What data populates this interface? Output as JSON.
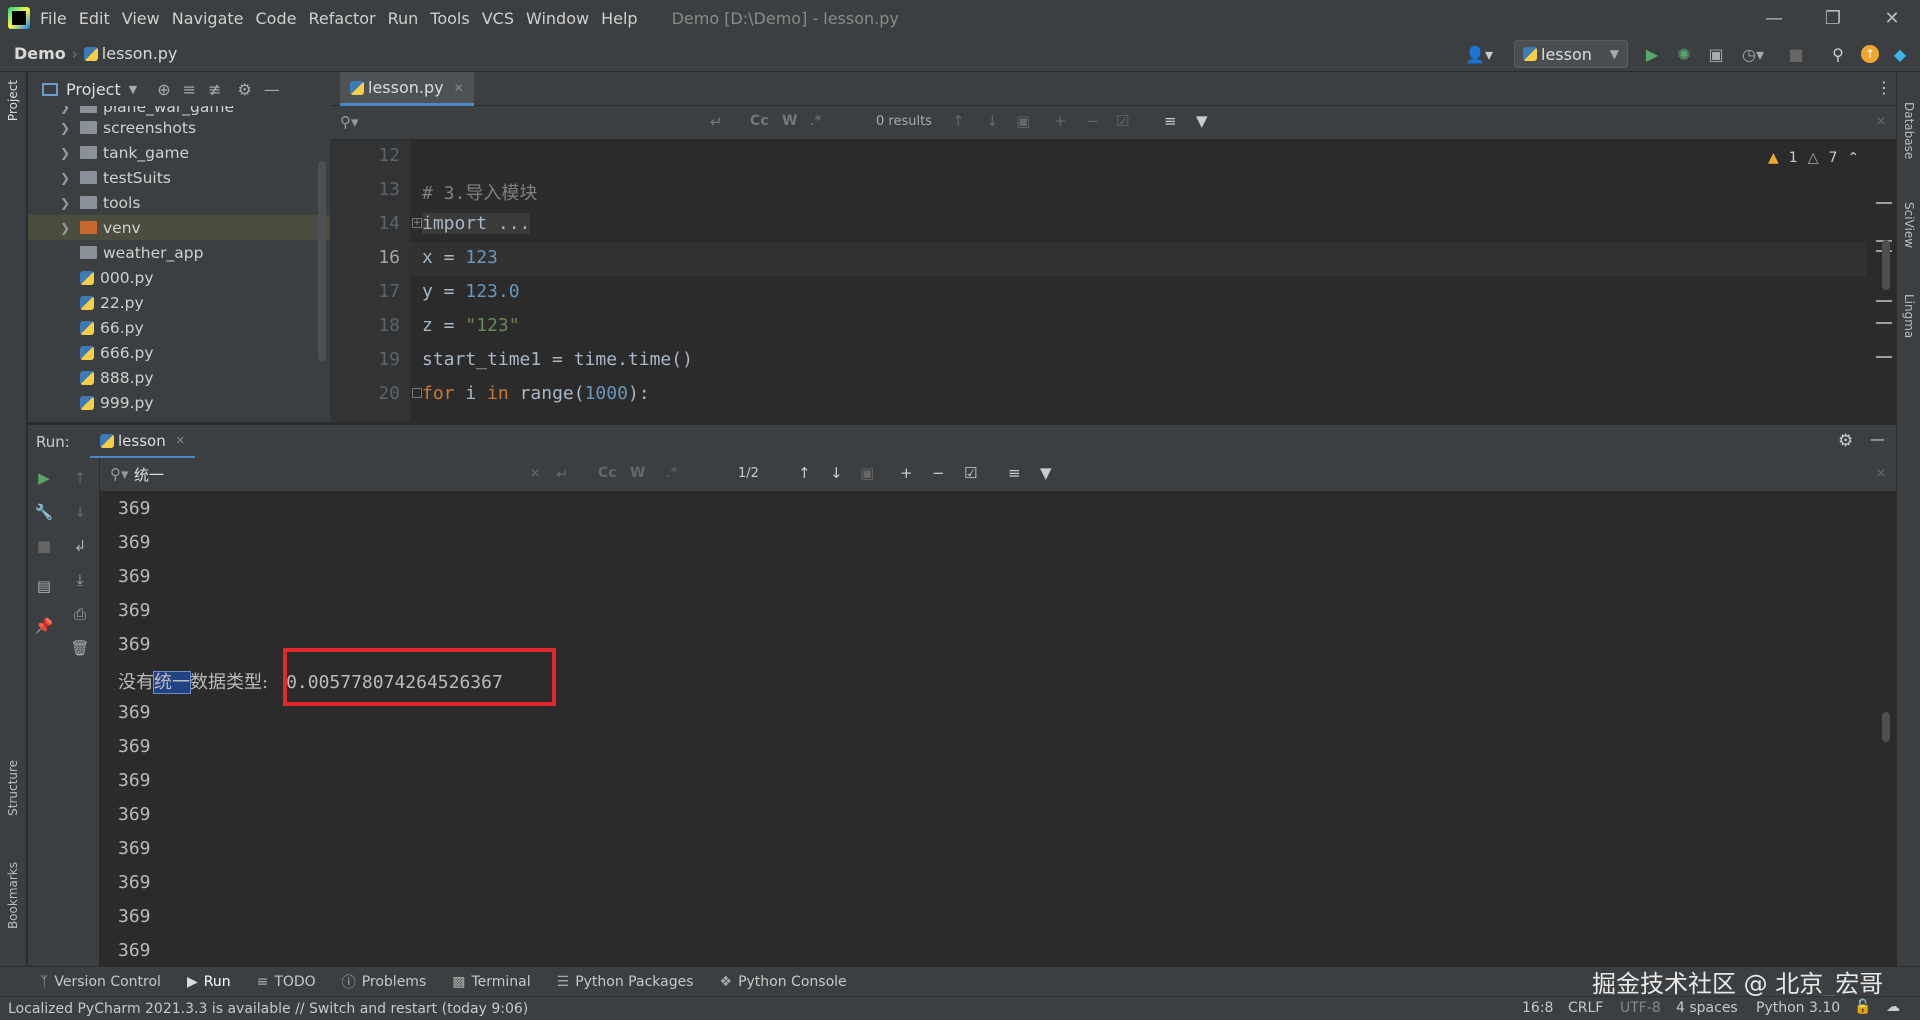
{
  "app": {
    "menu": [
      "File",
      "Edit",
      "View",
      "Navigate",
      "Code",
      "Refactor",
      "Run",
      "Tools",
      "VCS",
      "Window",
      "Help"
    ],
    "window_title": "Demo [D:\\Demo] - lesson.py"
  },
  "navbar": {
    "project": "Demo",
    "file": "lesson.py",
    "run_config": "lesson"
  },
  "side": {
    "project": "Project",
    "structure": "Structure",
    "bookmarks": "Bookmarks",
    "database": "Database",
    "sciview": "SciView",
    "lingma": "Lingma"
  },
  "project_panel": {
    "title": "Project",
    "items": [
      {
        "name": "plane_war_game",
        "type": "folder"
      },
      {
        "name": "screenshots",
        "type": "folder"
      },
      {
        "name": "tank_game",
        "type": "folder"
      },
      {
        "name": "testSuits",
        "type": "folder"
      },
      {
        "name": "tools",
        "type": "folder"
      },
      {
        "name": "venv",
        "type": "venv"
      },
      {
        "name": "weather_app",
        "type": "folder"
      },
      {
        "name": "000.py",
        "type": "py"
      },
      {
        "name": "22.py",
        "type": "py"
      },
      {
        "name": "66.py",
        "type": "py"
      },
      {
        "name": "666.py",
        "type": "py"
      },
      {
        "name": "888.py",
        "type": "py"
      },
      {
        "name": "999.py",
        "type": "py"
      }
    ]
  },
  "editor": {
    "tab": "lesson.py",
    "search_results": "0 results",
    "warnings": "1",
    "weak_warnings": "7",
    "line_numbers": [
      "12",
      "13",
      "14",
      "16",
      "17",
      "18",
      "19",
      "20"
    ],
    "lines": [
      {
        "text": ""
      },
      {
        "parts": [
          {
            "t": "# 3.导入模块",
            "c": "cmt"
          }
        ]
      },
      {
        "parts": [
          {
            "t": "import ...",
            "c": "kw"
          }
        ]
      },
      {
        "parts": [
          {
            "t": "x = ",
            "c": ""
          },
          {
            "t": "123",
            "c": "num"
          }
        ]
      },
      {
        "parts": [
          {
            "t": "y = ",
            "c": ""
          },
          {
            "t": "123.0",
            "c": "num"
          }
        ]
      },
      {
        "parts": [
          {
            "t": "z = ",
            "c": ""
          },
          {
            "t": "\"123\"",
            "c": "str"
          }
        ]
      },
      {
        "parts": [
          {
            "t": "start_time1 = time.time()",
            "c": ""
          }
        ]
      },
      {
        "parts": [
          {
            "t": "for ",
            "c": "kw"
          },
          {
            "t": "i ",
            "c": ""
          },
          {
            "t": "in ",
            "c": "kw"
          },
          {
            "t": "range(",
            "c": ""
          },
          {
            "t": "1000",
            "c": "num"
          },
          {
            "t": "):",
            "c": ""
          }
        ]
      }
    ]
  },
  "run": {
    "label": "Run:",
    "tab": "lesson",
    "search_query": "统一",
    "match_count": "1/2",
    "output": [
      "369",
      "369",
      "369",
      "369",
      "369"
    ],
    "result_prefix": "没有",
    "result_highlight": "统一",
    "result_suffix": "数据类型:",
    "result_value": "0.005778074264526367",
    "output_after": [
      "369",
      "369",
      "369",
      "369",
      "369",
      "369",
      "369",
      "369"
    ]
  },
  "bottom_tabs": [
    "Version Control",
    "Run",
    "TODO",
    "Problems",
    "Terminal",
    "Python Packages",
    "Python Console"
  ],
  "status": {
    "message": "Localized PyCharm 2021.3.3 is available // Switch and restart (today 9:06)",
    "position": "16:8",
    "line_sep": "CRLF",
    "encoding": "UTF-8",
    "indent": "4 spaces",
    "interpreter": "Python 3.10"
  },
  "watermark": "掘金技术社区 @ 北京_宏哥",
  "colors": {
    "accent": "#4a88c7",
    "highlight_box": "#e0282e",
    "search_match": "#214283"
  }
}
